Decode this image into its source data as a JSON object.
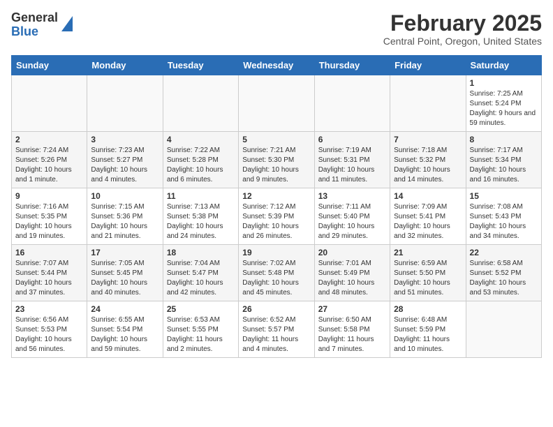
{
  "header": {
    "logo_general": "General",
    "logo_blue": "Blue",
    "main_title": "February 2025",
    "subtitle": "Central Point, Oregon, United States"
  },
  "calendar": {
    "days_of_week": [
      "Sunday",
      "Monday",
      "Tuesday",
      "Wednesday",
      "Thursday",
      "Friday",
      "Saturday"
    ],
    "weeks": [
      [
        {
          "day": "",
          "info": ""
        },
        {
          "day": "",
          "info": ""
        },
        {
          "day": "",
          "info": ""
        },
        {
          "day": "",
          "info": ""
        },
        {
          "day": "",
          "info": ""
        },
        {
          "day": "",
          "info": ""
        },
        {
          "day": "1",
          "info": "Sunrise: 7:25 AM\nSunset: 5:24 PM\nDaylight: 9 hours and 59 minutes."
        }
      ],
      [
        {
          "day": "2",
          "info": "Sunrise: 7:24 AM\nSunset: 5:26 PM\nDaylight: 10 hours and 1 minute."
        },
        {
          "day": "3",
          "info": "Sunrise: 7:23 AM\nSunset: 5:27 PM\nDaylight: 10 hours and 4 minutes."
        },
        {
          "day": "4",
          "info": "Sunrise: 7:22 AM\nSunset: 5:28 PM\nDaylight: 10 hours and 6 minutes."
        },
        {
          "day": "5",
          "info": "Sunrise: 7:21 AM\nSunset: 5:30 PM\nDaylight: 10 hours and 9 minutes."
        },
        {
          "day": "6",
          "info": "Sunrise: 7:19 AM\nSunset: 5:31 PM\nDaylight: 10 hours and 11 minutes."
        },
        {
          "day": "7",
          "info": "Sunrise: 7:18 AM\nSunset: 5:32 PM\nDaylight: 10 hours and 14 minutes."
        },
        {
          "day": "8",
          "info": "Sunrise: 7:17 AM\nSunset: 5:34 PM\nDaylight: 10 hours and 16 minutes."
        }
      ],
      [
        {
          "day": "9",
          "info": "Sunrise: 7:16 AM\nSunset: 5:35 PM\nDaylight: 10 hours and 19 minutes."
        },
        {
          "day": "10",
          "info": "Sunrise: 7:15 AM\nSunset: 5:36 PM\nDaylight: 10 hours and 21 minutes."
        },
        {
          "day": "11",
          "info": "Sunrise: 7:13 AM\nSunset: 5:38 PM\nDaylight: 10 hours and 24 minutes."
        },
        {
          "day": "12",
          "info": "Sunrise: 7:12 AM\nSunset: 5:39 PM\nDaylight: 10 hours and 26 minutes."
        },
        {
          "day": "13",
          "info": "Sunrise: 7:11 AM\nSunset: 5:40 PM\nDaylight: 10 hours and 29 minutes."
        },
        {
          "day": "14",
          "info": "Sunrise: 7:09 AM\nSunset: 5:41 PM\nDaylight: 10 hours and 32 minutes."
        },
        {
          "day": "15",
          "info": "Sunrise: 7:08 AM\nSunset: 5:43 PM\nDaylight: 10 hours and 34 minutes."
        }
      ],
      [
        {
          "day": "16",
          "info": "Sunrise: 7:07 AM\nSunset: 5:44 PM\nDaylight: 10 hours and 37 minutes."
        },
        {
          "day": "17",
          "info": "Sunrise: 7:05 AM\nSunset: 5:45 PM\nDaylight: 10 hours and 40 minutes."
        },
        {
          "day": "18",
          "info": "Sunrise: 7:04 AM\nSunset: 5:47 PM\nDaylight: 10 hours and 42 minutes."
        },
        {
          "day": "19",
          "info": "Sunrise: 7:02 AM\nSunset: 5:48 PM\nDaylight: 10 hours and 45 minutes."
        },
        {
          "day": "20",
          "info": "Sunrise: 7:01 AM\nSunset: 5:49 PM\nDaylight: 10 hours and 48 minutes."
        },
        {
          "day": "21",
          "info": "Sunrise: 6:59 AM\nSunset: 5:50 PM\nDaylight: 10 hours and 51 minutes."
        },
        {
          "day": "22",
          "info": "Sunrise: 6:58 AM\nSunset: 5:52 PM\nDaylight: 10 hours and 53 minutes."
        }
      ],
      [
        {
          "day": "23",
          "info": "Sunrise: 6:56 AM\nSunset: 5:53 PM\nDaylight: 10 hours and 56 minutes."
        },
        {
          "day": "24",
          "info": "Sunrise: 6:55 AM\nSunset: 5:54 PM\nDaylight: 10 hours and 59 minutes."
        },
        {
          "day": "25",
          "info": "Sunrise: 6:53 AM\nSunset: 5:55 PM\nDaylight: 11 hours and 2 minutes."
        },
        {
          "day": "26",
          "info": "Sunrise: 6:52 AM\nSunset: 5:57 PM\nDaylight: 11 hours and 4 minutes."
        },
        {
          "day": "27",
          "info": "Sunrise: 6:50 AM\nSunset: 5:58 PM\nDaylight: 11 hours and 7 minutes."
        },
        {
          "day": "28",
          "info": "Sunrise: 6:48 AM\nSunset: 5:59 PM\nDaylight: 11 hours and 10 minutes."
        },
        {
          "day": "",
          "info": ""
        }
      ]
    ]
  }
}
